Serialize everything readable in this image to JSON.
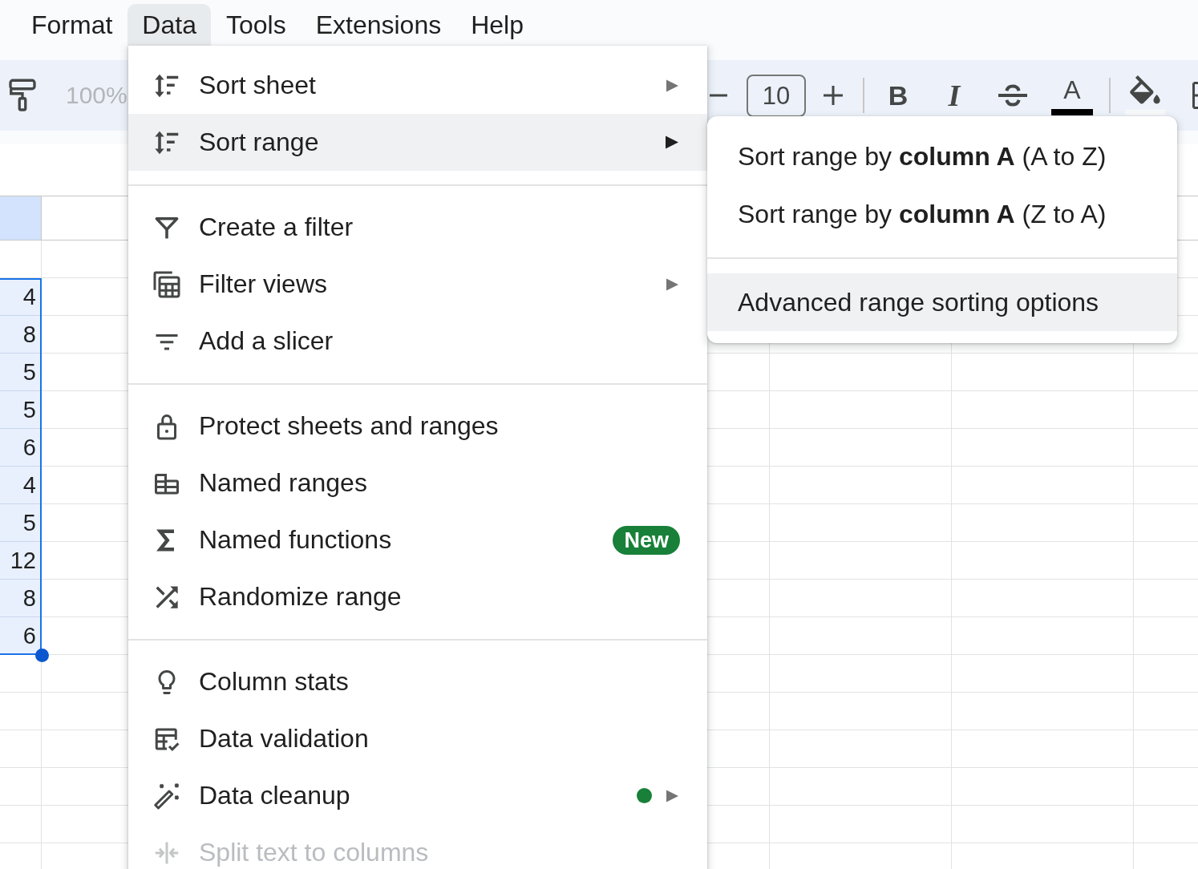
{
  "menu_bar": [
    {
      "label": "Format",
      "selected": false
    },
    {
      "label": "Data",
      "selected": true
    },
    {
      "label": "Tools",
      "selected": false
    },
    {
      "label": "Extensions",
      "selected": false
    },
    {
      "label": "Help",
      "selected": false
    }
  ],
  "toolbar": {
    "zoom": "100%",
    "font_size": "10",
    "bold": "B",
    "italic": "I",
    "text_color": "A"
  },
  "sheet": {
    "column_1": {
      "selected": true,
      "cells": [
        {
          "value": "4",
          "selected": true
        },
        {
          "value": "8",
          "selected": true
        },
        {
          "value": "5",
          "selected": true
        },
        {
          "value": "5",
          "selected": true
        },
        {
          "value": "6",
          "selected": true
        },
        {
          "value": "4",
          "selected": true
        },
        {
          "value": "5",
          "selected": true
        },
        {
          "value": "12",
          "selected": true
        },
        {
          "value": "8",
          "selected": true
        },
        {
          "value": "6",
          "selected": true
        }
      ]
    }
  },
  "data_menu": {
    "groups": [
      {
        "items": [
          {
            "label": "Sort sheet",
            "submenu": true,
            "selected": false,
            "disabled": false,
            "dot": false
          },
          {
            "label": "Sort range",
            "submenu": true,
            "selected": true,
            "disabled": false,
            "dot": false
          }
        ]
      },
      {
        "items": [
          {
            "label": "Create a filter",
            "submenu": false,
            "selected": false,
            "disabled": false,
            "dot": false
          },
          {
            "label": "Filter views",
            "submenu": true,
            "selected": false,
            "disabled": false,
            "dot": false
          },
          {
            "label": "Add a slicer",
            "submenu": false,
            "selected": false,
            "disabled": false,
            "dot": false
          }
        ]
      },
      {
        "items": [
          {
            "label": "Protect sheets and ranges",
            "submenu": false,
            "selected": false,
            "disabled": false,
            "dot": false
          },
          {
            "label": "Named ranges",
            "submenu": false,
            "selected": false,
            "disabled": false,
            "dot": false
          },
          {
            "label": "Named functions",
            "submenu": false,
            "selected": false,
            "disabled": false,
            "dot": false,
            "badge": "New"
          },
          {
            "label": "Randomize range",
            "submenu": false,
            "selected": false,
            "disabled": false,
            "dot": false
          }
        ]
      },
      {
        "items": [
          {
            "label": "Column stats",
            "submenu": false,
            "selected": false,
            "disabled": false,
            "dot": false
          },
          {
            "label": "Data validation",
            "submenu": false,
            "selected": false,
            "disabled": false,
            "dot": false
          },
          {
            "label": "Data cleanup",
            "submenu": true,
            "selected": false,
            "disabled": false,
            "dot": true
          },
          {
            "label": "Split text to columns",
            "submenu": false,
            "selected": false,
            "disabled": true,
            "dot": false
          }
        ]
      }
    ]
  },
  "sort_range_submenu": {
    "groups": [
      {
        "items": [
          {
            "label": "Sort range by **column A** (A to Z)",
            "selected": false
          },
          {
            "label": "Sort range by **column A** (Z to A)",
            "selected": false
          }
        ]
      },
      {
        "items": [
          {
            "label": "Advanced range sorting options",
            "selected": true
          }
        ]
      }
    ]
  }
}
